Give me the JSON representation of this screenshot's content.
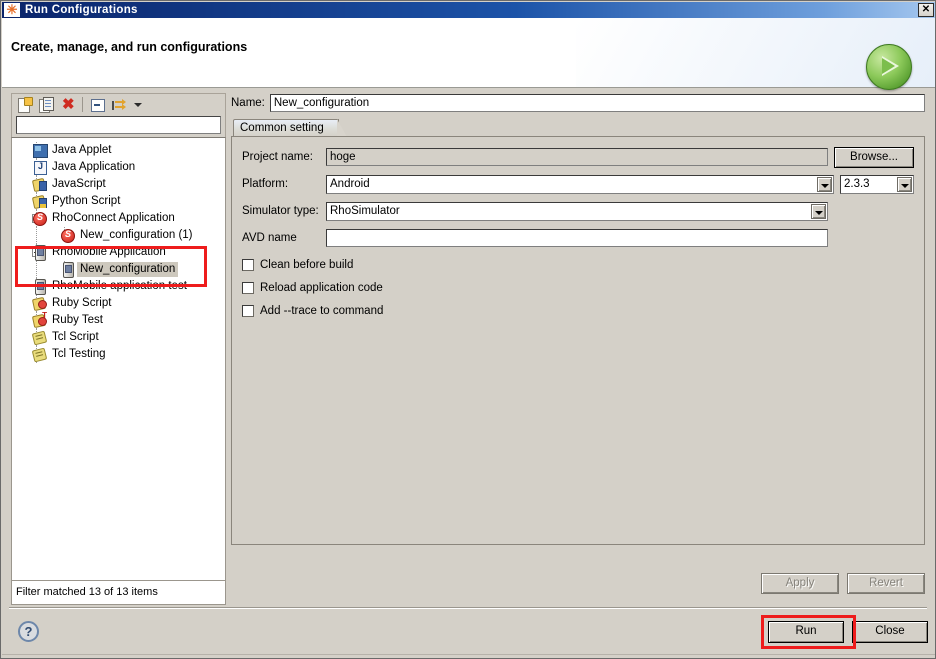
{
  "window": {
    "title": "Run Configurations",
    "icon": "eclipse-star-icon",
    "close_label": "✕"
  },
  "banner": {
    "heading": "Create, manage, and run configurations",
    "badge_icon": "green-run-play-icon"
  },
  "left_panel": {
    "toolbar": {
      "new_icon": "new-configuration-icon",
      "duplicate_icon": "duplicate-configuration-icon",
      "delete_icon": "delete-configuration-icon",
      "collapse_icon": "collapse-all-icon",
      "filter_icon": "filter-link-icon",
      "dropdown_icon": "chevron-down-icon"
    },
    "filter_input": {
      "value": "",
      "placeholder": ""
    },
    "tree": [
      {
        "label": "Java Applet",
        "level": 1,
        "icon": "java-applet-icon",
        "expander": false,
        "selected": false
      },
      {
        "label": "Java Application",
        "level": 1,
        "icon": "java-application-icon",
        "expander": false,
        "selected": false
      },
      {
        "label": "JavaScript",
        "level": 1,
        "icon": "javascript-icon",
        "expander": false,
        "selected": false
      },
      {
        "label": "Python Script",
        "level": 1,
        "icon": "python-script-icon",
        "expander": false,
        "selected": false
      },
      {
        "label": "RhoConnect Application",
        "level": 1,
        "icon": "rhoconnect-icon",
        "expander": true,
        "selected": false
      },
      {
        "label": "New_configuration (1)",
        "level": 2,
        "icon": "rhoconnect-icon",
        "expander": false,
        "selected": false
      },
      {
        "label": "RhoMobile Application",
        "level": 1,
        "icon": "rhomobile-device-icon",
        "expander": true,
        "selected": false
      },
      {
        "label": "New_configuration",
        "level": 2,
        "icon": "rhomobile-device-icon",
        "expander": false,
        "selected": true
      },
      {
        "label": "RhoMobile application test",
        "level": 1,
        "icon": "rhomobile-device-icon",
        "expander": false,
        "selected": false
      },
      {
        "label": "Ruby Script",
        "level": 1,
        "icon": "ruby-script-icon",
        "expander": false,
        "selected": false
      },
      {
        "label": "Ruby Test",
        "level": 1,
        "icon": "ruby-test-icon",
        "expander": false,
        "selected": false
      },
      {
        "label": "Tcl Script",
        "level": 1,
        "icon": "tcl-script-icon",
        "expander": false,
        "selected": false
      },
      {
        "label": "Tcl Testing",
        "level": 1,
        "icon": "tcl-testing-icon",
        "expander": false,
        "selected": false
      }
    ],
    "status": "Filter matched 13 of 13 items"
  },
  "right_panel": {
    "name_label": "Name:",
    "name_value": "New_configuration",
    "tab_label": "Common setting",
    "fields": {
      "project_label": "Project name:",
      "project_value": "hoge",
      "browse_label": "Browse...",
      "platform_label": "Platform:",
      "platform_value": "Android",
      "version_value": "2.3.3",
      "simulator_label": "Simulator type:",
      "simulator_value": "RhoSimulator",
      "avd_label": "AVD name",
      "avd_value": ""
    },
    "checkboxes": [
      {
        "label": "Clean before build",
        "checked": false
      },
      {
        "label": "Reload application code",
        "checked": false
      },
      {
        "label": "Add --trace to command",
        "checked": false
      }
    ],
    "apply_label": "Apply",
    "revert_label": "Revert"
  },
  "footer": {
    "help_icon": "help-question-icon",
    "run_label": "Run",
    "close_label": "Close"
  },
  "annotations": {
    "tree_highlight_color": "#ee1c1c",
    "run_highlight_color": "#ee1c1c"
  }
}
